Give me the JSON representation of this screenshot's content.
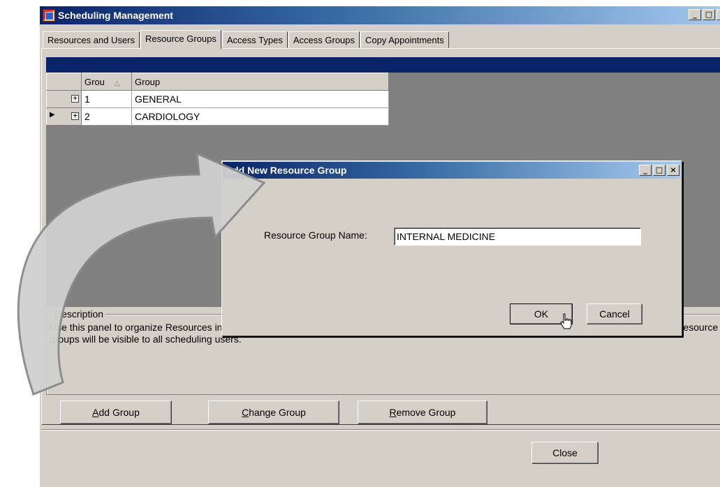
{
  "window": {
    "title": "Scheduling Management",
    "caption_buttons": [
      "_",
      "□",
      "×"
    ]
  },
  "tabs": [
    {
      "label": "Resources and Users",
      "active": false
    },
    {
      "label": "Resource Groups",
      "active": true
    },
    {
      "label": "Access Types",
      "active": false
    },
    {
      "label": "Access Groups",
      "active": false
    },
    {
      "label": "Copy Appointments",
      "active": false
    }
  ],
  "grid": {
    "columns": [
      "Grou",
      "Group"
    ],
    "rows": [
      {
        "id": "1",
        "name": "GENERAL"
      },
      {
        "id": "2",
        "name": "CARDIOLOGY"
      }
    ]
  },
  "description": {
    "legend": "Description",
    "text": "Use this panel to organize Resources into useful groups.  Resource groups may include departments, clinics or any other collection of resources.  Resource groups will be visible to all scheduling users."
  },
  "actions": {
    "add_group": {
      "pre": "",
      "key": "A",
      "post": "dd Group"
    },
    "change_group": {
      "pre": "",
      "key": "C",
      "post": "hange Group"
    },
    "remove_group": {
      "pre": "",
      "key": "R",
      "post": "emove Group"
    },
    "close": "Close"
  },
  "dialog": {
    "title": "Add New Resource Group",
    "field_label": "Resource Group Name:",
    "field_value": "INTERNAL MEDICINE",
    "ok_label": "OK",
    "cancel_label": "Cancel"
  },
  "colors": {
    "title_active": "#0a246a",
    "face": "#d4d0c8",
    "grid_bg": "#808080"
  }
}
